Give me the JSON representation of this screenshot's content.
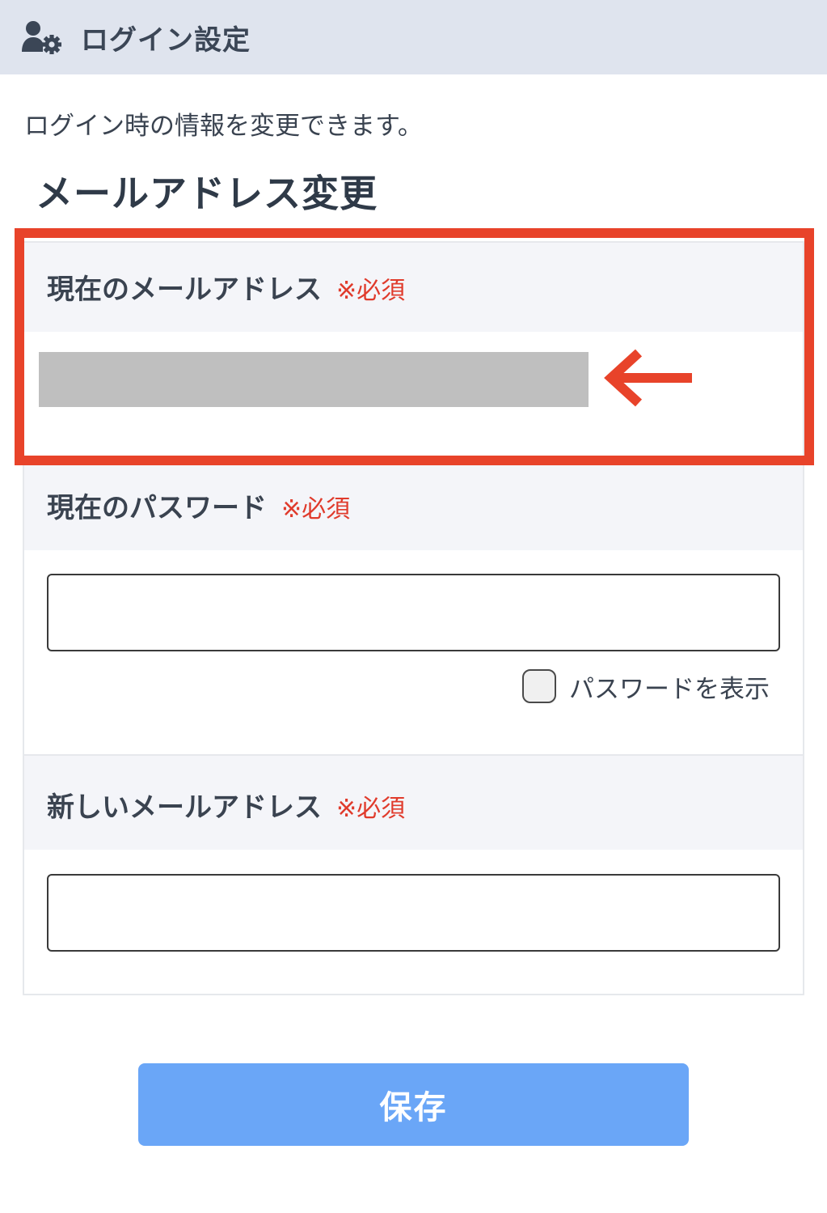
{
  "header": {
    "title": "ログイン設定",
    "icon": "user-gear-icon"
  },
  "intro_text": "ログイン時の情報を変更できます。",
  "section_title": "メールアドレス変更",
  "fields": {
    "current_email": {
      "label": "現在のメールアドレス",
      "required": "※必須",
      "value": ""
    },
    "current_password": {
      "label": "現在のパスワード",
      "required": "※必須",
      "value": ""
    },
    "show_password": {
      "label": "パスワードを表示",
      "checked": false
    },
    "new_email": {
      "label": "新しいメールアドレス",
      "required": "※必須",
      "value": ""
    }
  },
  "save_button": {
    "label": "保存"
  },
  "colors": {
    "accent_blue": "#6aa6f7",
    "highlight_red": "#e8432a",
    "required_red": "#e03b2c"
  }
}
